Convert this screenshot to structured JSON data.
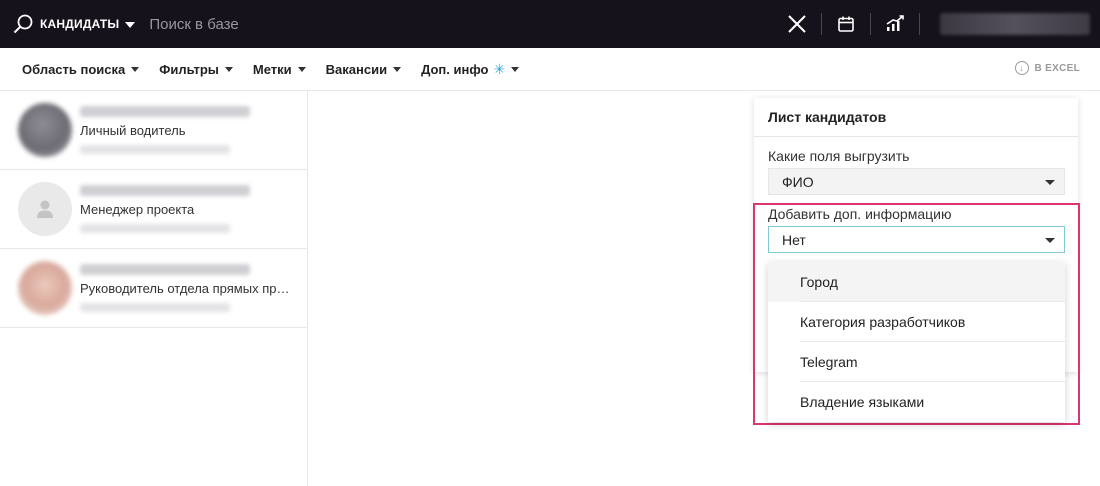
{
  "topbar": {
    "scope_label": "КАНДИДАТЫ",
    "search_placeholder": "Поиск в базе",
    "icons": [
      "search-icon",
      "close-icon",
      "calendar-icon",
      "analytics-icon"
    ]
  },
  "filters": {
    "items": [
      {
        "label": "Область поиска"
      },
      {
        "label": "Фильтры"
      },
      {
        "label": "Метки"
      },
      {
        "label": "Вакансии"
      },
      {
        "label": "Доп. инфо",
        "icon": "snowflake-icon"
      }
    ],
    "excel_label": "В EXCEL"
  },
  "candidates": [
    {
      "role": "Личный водитель"
    },
    {
      "role": "Менеджер проекта"
    },
    {
      "role": "Руководитель отдела прямых продаж"
    }
  ],
  "export_panel": {
    "title": "Лист кандидатов",
    "fields_label": "Какие поля выгрузить",
    "fields_value": "ФИО",
    "extra_label": "Добавить доп. информацию",
    "extra_value": "Нет",
    "options": [
      "Город",
      "Категория разработчиков",
      "Telegram",
      "Владение языками"
    ]
  },
  "colors": {
    "topbar_bg": "#16121b",
    "highlight": "#dd3572",
    "accent": "#29a8d8"
  }
}
